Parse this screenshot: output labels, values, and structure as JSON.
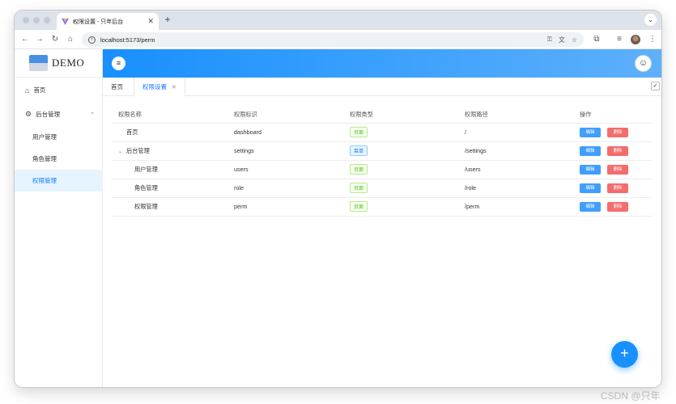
{
  "browser": {
    "tab_title": "权限设置 - 只年后台",
    "url": "localhost:5173/perm"
  },
  "sidebar": {
    "logo_text": "DEMO",
    "items": [
      {
        "label": "首页",
        "icon": "home-icon"
      },
      {
        "label": "后台管理",
        "icon": "gear-icon"
      },
      {
        "label": "用户管理"
      },
      {
        "label": "角色管理"
      },
      {
        "label": "权限管理",
        "active": true
      }
    ]
  },
  "tags": {
    "home": "首页",
    "current": "权限设置"
  },
  "table": {
    "headers": [
      "权限名称",
      "权限标识",
      "权限类型",
      "权限路径",
      "操作"
    ],
    "rows": [
      {
        "name": "首页",
        "key": "dashboard",
        "type": "页面",
        "path": "/"
      },
      {
        "name": "后台管理",
        "key": "settings",
        "type": "菜单",
        "path": "/settings"
      },
      {
        "name": "用户管理",
        "key": "users",
        "type": "页面",
        "path": "/users"
      },
      {
        "name": "角色管理",
        "key": "role",
        "type": "页面",
        "path": "/role"
      },
      {
        "name": "权限管理",
        "key": "perm",
        "type": "页面",
        "path": "/perm"
      }
    ],
    "edit_label": "编辑",
    "delete_label": "删除"
  },
  "fab": {
    "label": "+"
  },
  "watermark": "CSDN @只年",
  "colors": {
    "accent": "#1890ff",
    "danger": "#f56c6c",
    "success": "#52c41a"
  }
}
